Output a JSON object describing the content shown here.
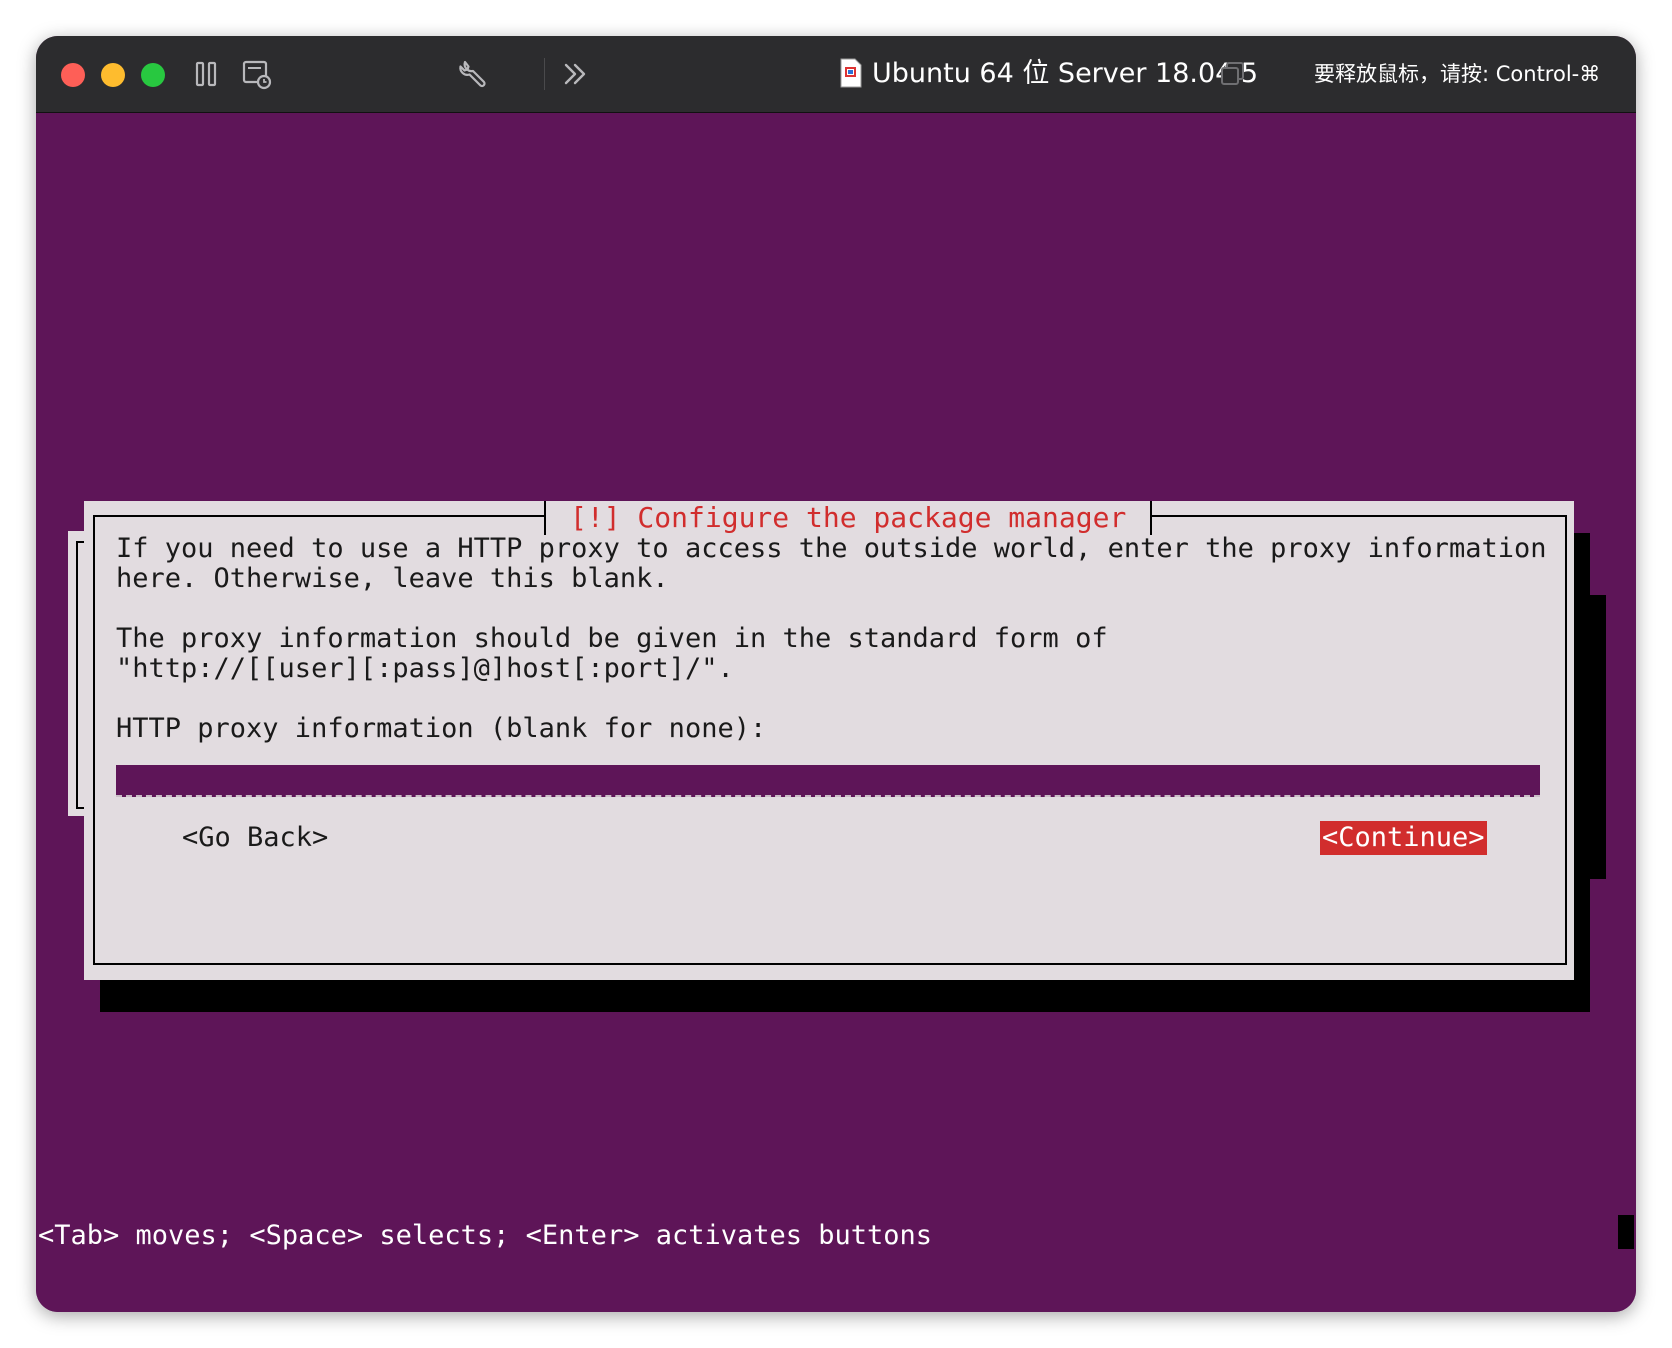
{
  "window": {
    "title": "Ubuntu 64 位 Server 18.04.5",
    "release_hint": "要释放鼠标，请按: Control-⌘"
  },
  "toolbar": {
    "icons": [
      "pause-icon",
      "snapshot-icon",
      "wrench-icon",
      "chevron-double-right-icon",
      "document-icon",
      "window-copy-icon"
    ]
  },
  "dialog": {
    "title": "[!] Configure the package manager",
    "paragraph1_line1": "If you need to use a HTTP proxy to access the outside world, enter the proxy information",
    "paragraph1_line2": "here. Otherwise, leave this blank.",
    "paragraph2_line1": "The proxy information should be given in the standard form of",
    "paragraph2_line2": "\"http://[[user][:pass]@]host[:port]/\".",
    "input_label": "HTTP proxy information (blank for none):",
    "input_value": "",
    "back_button": "<Go Back>",
    "continue_button": "<Continue>"
  },
  "status_bar": {
    "help_text": "<Tab> moves; <Space> selects; <Enter> activates buttons"
  },
  "colors": {
    "terminal_background": "#5e1558",
    "dialog_background": "#e2dce0",
    "title_accent": "#d12d2d",
    "titlebar": "#2c2c2e"
  }
}
